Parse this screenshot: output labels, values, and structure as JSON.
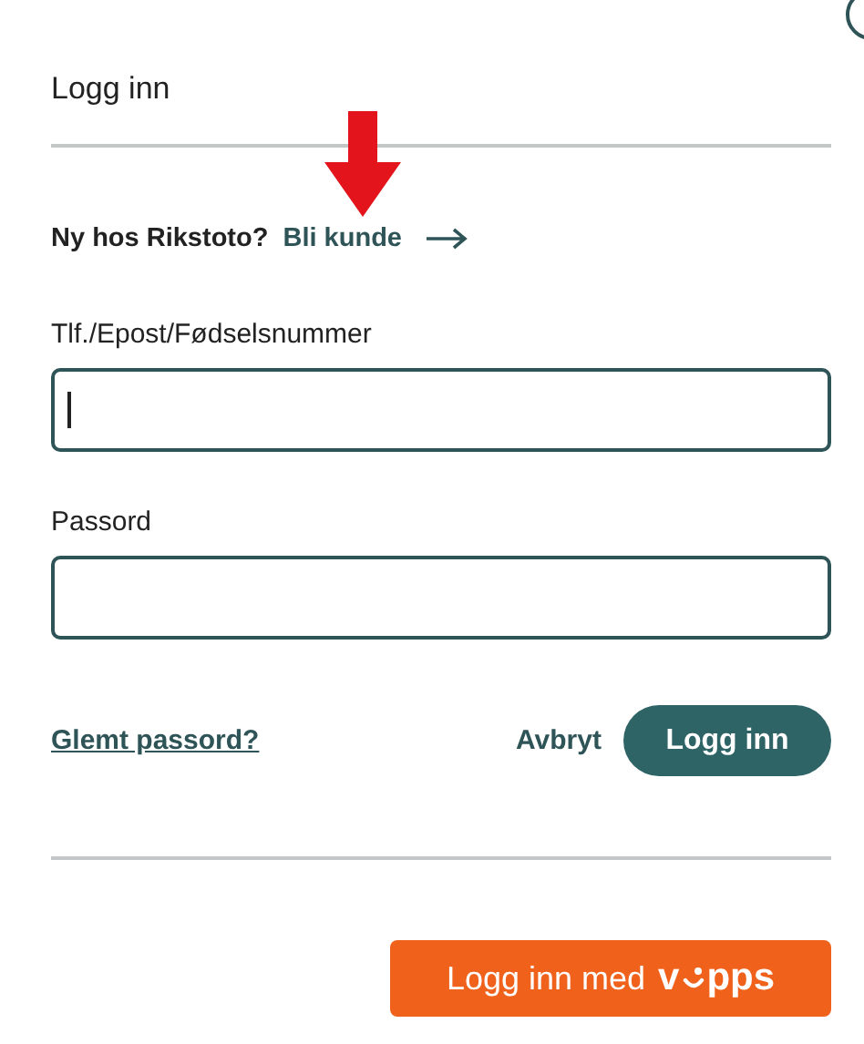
{
  "title": "Logg inn",
  "signup": {
    "question": "Ny hos Rikstoto?",
    "link": "Bli kunde"
  },
  "fields": [
    {
      "label": "Tlf./Epost/Fødselsnummer",
      "focused": true
    },
    {
      "label": "Passord",
      "focused": false
    }
  ],
  "forgot_link": "Glemt passord?",
  "cancel_button": "Avbryt",
  "login_button": "Logg inn",
  "vipps_button": {
    "label": "Logg inn med",
    "logo_start": "v",
    "logo_end": "pps"
  }
}
